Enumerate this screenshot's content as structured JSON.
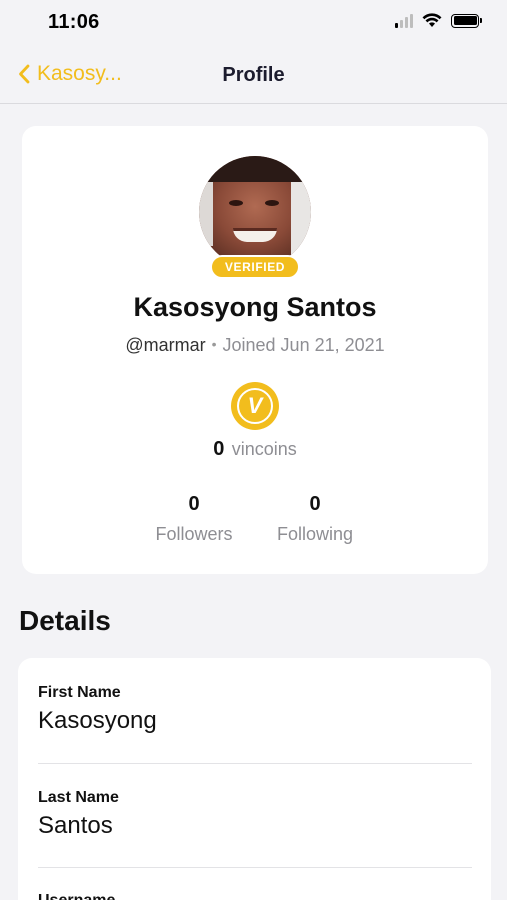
{
  "status_bar": {
    "time": "11:06",
    "icons": [
      "signal-icon",
      "wifi-icon",
      "battery-icon"
    ]
  },
  "nav": {
    "back_label": "Kasosy...",
    "title": "Profile"
  },
  "profile": {
    "verified_label": "VERIFIED",
    "display_name": "Kasosyong Santos",
    "handle": "@marmar",
    "separator": "•",
    "joined": "Joined Jun 21, 2021",
    "coin_symbol": "V",
    "coins_value": "0",
    "coins_unit": "vincoins",
    "followers_count": "0",
    "followers_label": "Followers",
    "following_count": "0",
    "following_label": "Following"
  },
  "details": {
    "heading": "Details",
    "fields": [
      {
        "label": "First Name",
        "value": "Kasosyong"
      },
      {
        "label": "Last Name",
        "value": "Santos"
      },
      {
        "label": "Username",
        "value": ""
      }
    ]
  },
  "colors": {
    "accent": "#f2bd1d",
    "background": "#f3f3f6",
    "card": "#ffffff",
    "secondary_text": "#8e8e93"
  }
}
